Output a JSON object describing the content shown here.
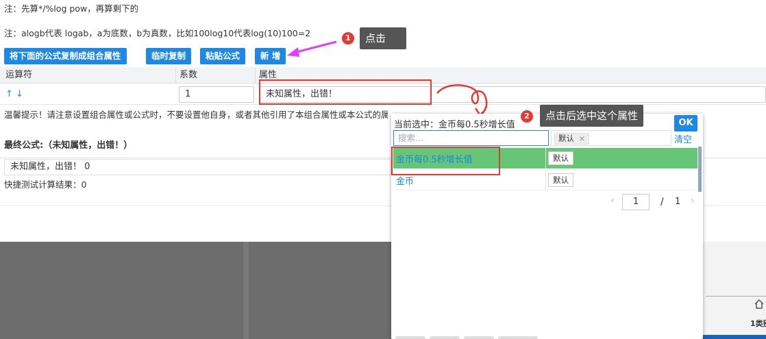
{
  "notes": {
    "line1": "注：先算*/%log pow，再算剩下的",
    "line2": "注：alogb代表 logab，a为底数，b为真数，比如100log10代表log(10)100=2"
  },
  "toolbar": {
    "copy_formula_label": "将下面的公式复制成组合属性",
    "temp_copy_label": "临时复制",
    "paste_formula_label": "粘贴公式",
    "add_label": "新 增"
  },
  "table": {
    "headers": [
      "运算符",
      "系数",
      "属性"
    ],
    "row": {
      "operator_arrows": "↑ ↓",
      "coefficient": "1",
      "attribute": "未知属性，出错！"
    }
  },
  "hint": "温馨提示！请注意设置组合属性或公式时，不要设置他自身，或者其他引用了本组合属性或本公式的属性，否则会引起循环引用，导致死循环。",
  "final_formula": {
    "label": "最终公式:（未知属性，出错！）",
    "value": "未知属性，出错！ 0",
    "quick_test": "快捷测试计算结果：0"
  },
  "annotations": {
    "step1_number": "1",
    "step1_text": "点击",
    "step2_number": "2",
    "step2_text": "点击后选中这个属性"
  },
  "picker": {
    "current_label": "当前选中：金币每0.5秒增长值",
    "ok_label": "OK",
    "search_placeholder": "搜索...",
    "tag_label": "默认",
    "tag_close": "×",
    "clear_label": "清空",
    "items": [
      {
        "name": "金币每0.5秒增长值",
        "tag": "默认",
        "selected": true
      },
      {
        "name": "金币",
        "tag": "默认",
        "selected": false
      }
    ],
    "pager": {
      "prev": "‹",
      "page": "1",
      "sep": "/",
      "total": "1",
      "next": "›"
    }
  },
  "colors": {
    "primary": "#1e88e5",
    "selected_row": "#66c676",
    "annotation_red": "#e53935",
    "arrow_magenta": "#e040fb"
  },
  "background_right": {
    "icon": "home-icon",
    "label": "1类别"
  }
}
